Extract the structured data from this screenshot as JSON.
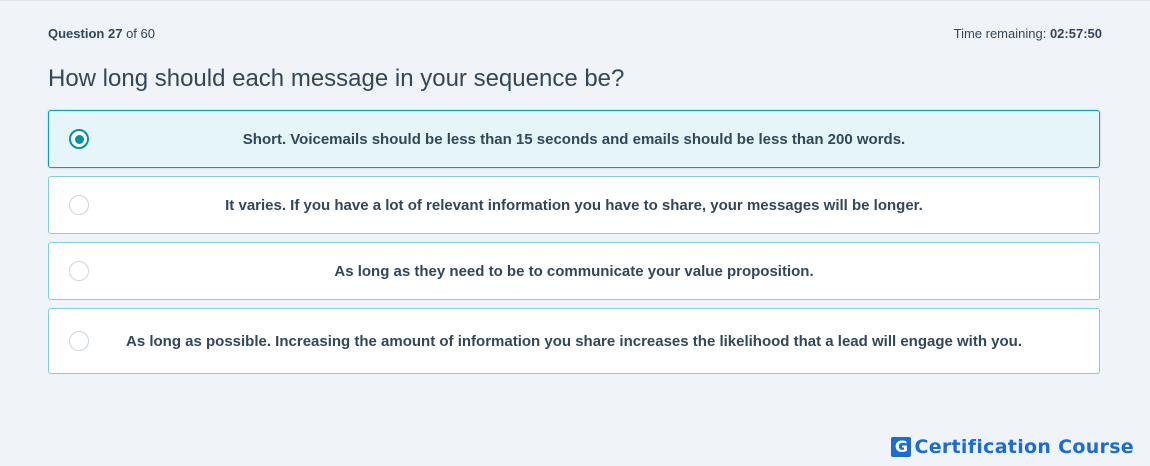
{
  "header": {
    "question_label": "Question",
    "question_number": "27",
    "of_label": "of 60",
    "time_label": "Time remaining:",
    "time_value": "02:57:50"
  },
  "question": {
    "text": "How long should each message in your sequence be?"
  },
  "options": [
    {
      "text": "Short. Voicemails should be less than 15 seconds and emails should be less than 200 words.",
      "selected": true
    },
    {
      "text": "It varies. If you have a lot of relevant information you have to share, your messages will be longer.",
      "selected": false
    },
    {
      "text": "As long as they need to be to communicate your value proposition.",
      "selected": false
    },
    {
      "text": "As long as possible. Increasing the amount of information you share increases the likelihood that a lead will engage with you.",
      "selected": false
    }
  ],
  "brand": {
    "icon_letter": "G",
    "name": "Certification Course",
    "color": "#1a6dd9"
  },
  "colors": {
    "accent": "#00a4bd",
    "radio_selected": "#0091ae",
    "selected_bg": "#e5f5f8",
    "text": "#33475b"
  }
}
